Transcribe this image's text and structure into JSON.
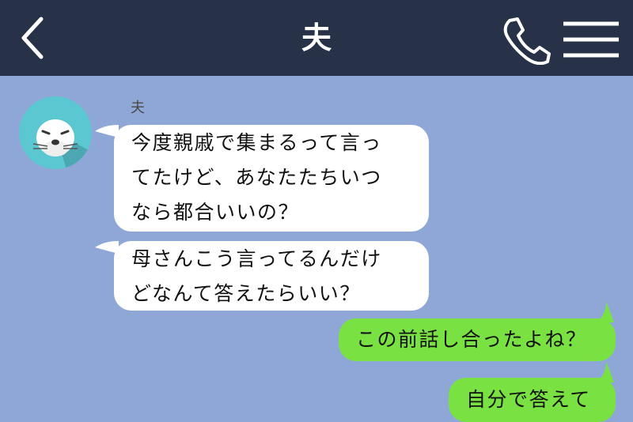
{
  "header": {
    "title": "夫",
    "back_icon": "chevron-left-icon",
    "call_icon": "phone-icon",
    "menu_icon": "hamburger-menu-icon",
    "background": "#273248"
  },
  "chat": {
    "background": "#8fa7d6",
    "contact_name": "夫",
    "incoming_color": "#ffffff",
    "outgoing_color": "#79e242",
    "messages": [
      {
        "sender": "夫",
        "text": "今度親戚で集まるって言っ\nてたけど、あなたたちいつ\nなら都合いいの？"
      },
      {
        "sender": "夫",
        "text": "母さんこう言ってるんだけ\nどなんて答えたらいい？"
      },
      {
        "sender": "me",
        "text": "この前話し合ったよね？"
      },
      {
        "sender": "me",
        "text": "自分で答えて"
      }
    ]
  }
}
